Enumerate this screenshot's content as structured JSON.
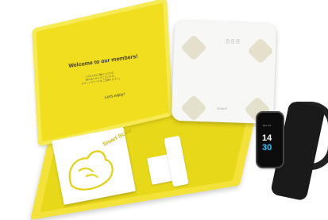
{
  "lid": {
    "title": "Welcome to our members!",
    "body_lines": [
      "このたびはご購入いただき、",
      "誠にありがとうございます。",
      "スマートスケールをご活用ください。"
    ],
    "sign": "Let's enjoy!"
  },
  "card": {
    "brand": "Smart Scale"
  },
  "scale": {
    "display": "888",
    "brand": "SCALE"
  },
  "watch": {
    "date": "Mon 10",
    "hour": "14",
    "minute": "30"
  },
  "colors": {
    "box_yellow": "#f1df1f",
    "scale_white": "#f7f7f5",
    "band_black": "#1a1a1a",
    "accent_blue": "#2bc7ff"
  }
}
